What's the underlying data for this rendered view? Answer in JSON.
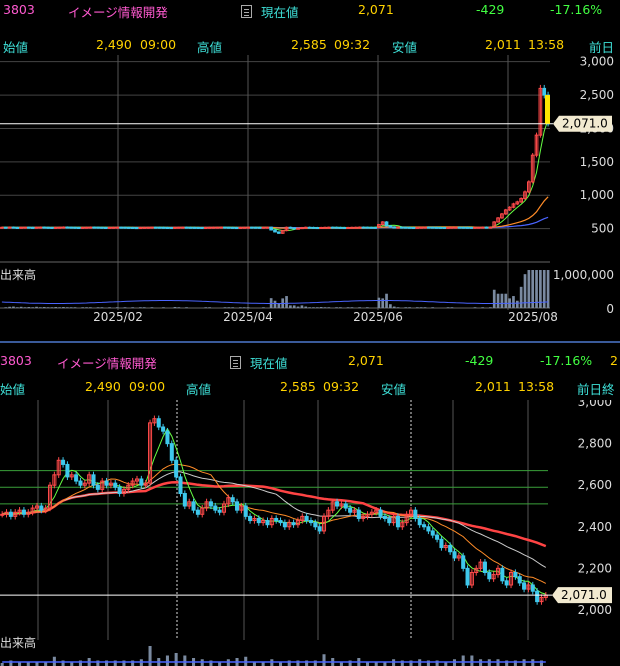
{
  "ticker": {
    "code": "3803",
    "name": "イメージ情報開発",
    "current_label": "現在値",
    "current": "2,071",
    "change": "-429",
    "change_pct": "-17.16%",
    "open_label": "始値",
    "open": "2,490",
    "open_time": "09:00",
    "high_label": "高値",
    "high": "2,585",
    "high_time": "09:32",
    "low_label": "安値",
    "low": "2,011",
    "low_time": "13:58",
    "prev_label_top": "前日",
    "prev_label_bottom": "前日終",
    "extra_bottom": "2"
  },
  "volume_label": "出来高",
  "colors": {
    "up": "#ff4a4a",
    "down": "#3ec8ec",
    "ma_red": "#ff4444",
    "ma_orange": "#ff8c28",
    "ma_white": "#cccccc",
    "ma_green": "#66ff44",
    "ma_blue": "#4a64ff",
    "price_line": "#ffffff",
    "price_tag_bg": "#f2ead0",
    "panel_divider": "#3a5a9a"
  },
  "chart_data": [
    {
      "type": "candlestick",
      "period": "daily",
      "xlabels": [
        "2025/02",
        "2025/04",
        "2025/06",
        "2025/08"
      ],
      "ylabels": [
        "3,000",
        "2,500",
        "2,000",
        "1,500",
        "1,000",
        "500"
      ],
      "ylim": [
        0,
        3100
      ],
      "current_price_tag": "2,071.0",
      "volume_ylabels": [
        "1,000,000",
        "0"
      ],
      "closes": [
        520,
        518,
        522,
        517,
        515,
        519,
        521,
        518,
        516,
        520,
        522,
        519,
        517,
        515,
        518,
        520,
        523,
        521,
        519,
        517,
        516,
        518,
        520,
        522,
        521,
        519,
        517,
        516,
        518,
        519,
        521,
        520,
        518,
        517,
        515,
        514,
        516,
        518,
        519,
        521,
        520,
        519,
        517,
        516,
        515,
        518,
        520,
        521,
        519,
        518,
        517,
        516,
        515,
        517,
        519,
        520,
        521,
        522,
        520,
        518,
        516,
        515,
        517,
        519,
        521,
        520,
        519,
        518,
        520,
        521,
        480,
        450,
        430,
        470,
        520,
        510,
        500,
        505,
        515,
        520,
        518,
        516,
        514,
        517,
        519,
        521,
        520,
        518,
        516,
        515,
        517,
        519,
        520,
        522,
        521,
        519,
        518,
        517,
        560,
        600,
        540,
        525,
        520,
        522,
        521,
        519,
        517,
        516,
        518,
        520,
        522,
        521,
        519,
        518,
        517,
        516,
        518,
        520,
        521,
        520,
        519,
        518,
        517,
        519,
        520,
        522,
        521,
        523,
        600,
        660,
        720,
        780,
        820,
        870,
        900,
        950,
        1050,
        1200,
        1600,
        1900,
        2600,
        2500,
        2071
      ]
    },
    {
      "type": "candlestick",
      "period": "intraday",
      "ylabels": [
        "3,000",
        "2,800",
        "2,600",
        "2,400",
        "2,200",
        "2,000"
      ],
      "ylim": [
        1990,
        3010
      ],
      "current_price_tag": "2,071.0",
      "reference_lines": [
        2670,
        2590,
        2510
      ],
      "closes": [
        2460,
        2470,
        2450,
        2470,
        2480,
        2460,
        2470,
        2490,
        2500,
        2480,
        2490,
        2600,
        2650,
        2720,
        2700,
        2640,
        2650,
        2620,
        2600,
        2610,
        2650,
        2600,
        2580,
        2620,
        2600,
        2610,
        2590,
        2560,
        2580,
        2600,
        2620,
        2630,
        2600,
        2610,
        2900,
        2920,
        2880,
        2860,
        2800,
        2720,
        2640,
        2560,
        2500,
        2520,
        2480,
        2460,
        2490,
        2520,
        2500,
        2480,
        2470,
        2510,
        2540,
        2520,
        2480,
        2500,
        2450,
        2430,
        2440,
        2420,
        2430,
        2410,
        2440,
        2430,
        2420,
        2400,
        2420,
        2410,
        2430,
        2450,
        2430,
        2420,
        2400,
        2380,
        2450,
        2480,
        2520,
        2500,
        2510,
        2490,
        2470,
        2480,
        2440,
        2450,
        2460,
        2470,
        2480,
        2450,
        2440,
        2420,
        2450,
        2400,
        2420,
        2460,
        2480,
        2440,
        2410,
        2400,
        2380,
        2360,
        2340,
        2300,
        2310,
        2280,
        2250,
        2260,
        2200,
        2120,
        2180,
        2200,
        2230,
        2180,
        2150,
        2170,
        2200,
        2140,
        2120,
        2180,
        2160,
        2130,
        2100,
        2120,
        2090,
        2040,
        2060,
        2071
      ]
    }
  ]
}
